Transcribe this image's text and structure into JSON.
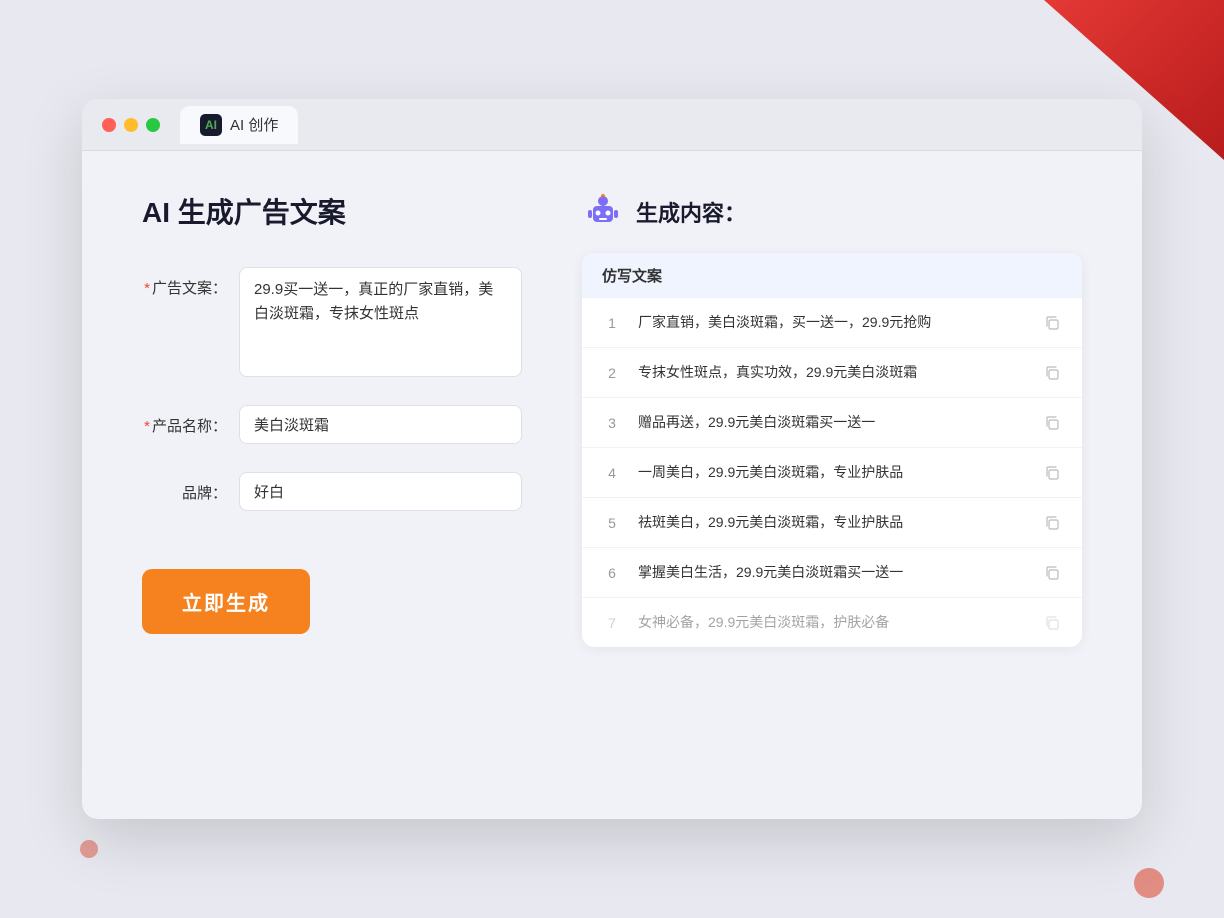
{
  "window": {
    "tab_label": "AI 创作",
    "tab_icon_text": "AI"
  },
  "left_panel": {
    "title": "AI 生成广告文案",
    "form": {
      "ad_copy_label": "广告文案：",
      "ad_copy_required": true,
      "ad_copy_value": "29.9买一送一，真正的厂家直销，美白淡斑霜，专抹女性斑点",
      "product_name_label": "产品名称：",
      "product_name_required": true,
      "product_name_value": "美白淡斑霜",
      "brand_label": "品牌：",
      "brand_required": false,
      "brand_value": "好白"
    },
    "generate_button": "立即生成"
  },
  "right_panel": {
    "header_title": "生成内容：",
    "table_header": "仿写文案",
    "results": [
      {
        "id": 1,
        "text": "厂家直销，美白淡斑霜，买一送一，29.9元抢购",
        "faded": false
      },
      {
        "id": 2,
        "text": "专抹女性斑点，真实功效，29.9元美白淡斑霜",
        "faded": false
      },
      {
        "id": 3,
        "text": "赠品再送，29.9元美白淡斑霜买一送一",
        "faded": false
      },
      {
        "id": 4,
        "text": "一周美白，29.9元美白淡斑霜，专业护肤品",
        "faded": false
      },
      {
        "id": 5,
        "text": "祛斑美白，29.9元美白淡斑霜，专业护肤品",
        "faded": false
      },
      {
        "id": 6,
        "text": "掌握美白生活，29.9元美白淡斑霜买一送一",
        "faded": false
      },
      {
        "id": 7,
        "text": "女神必备，29.9元美白淡斑霜，护肤必备",
        "faded": true
      }
    ]
  },
  "icons": {
    "copy": "⧉",
    "robot": "🤖"
  }
}
